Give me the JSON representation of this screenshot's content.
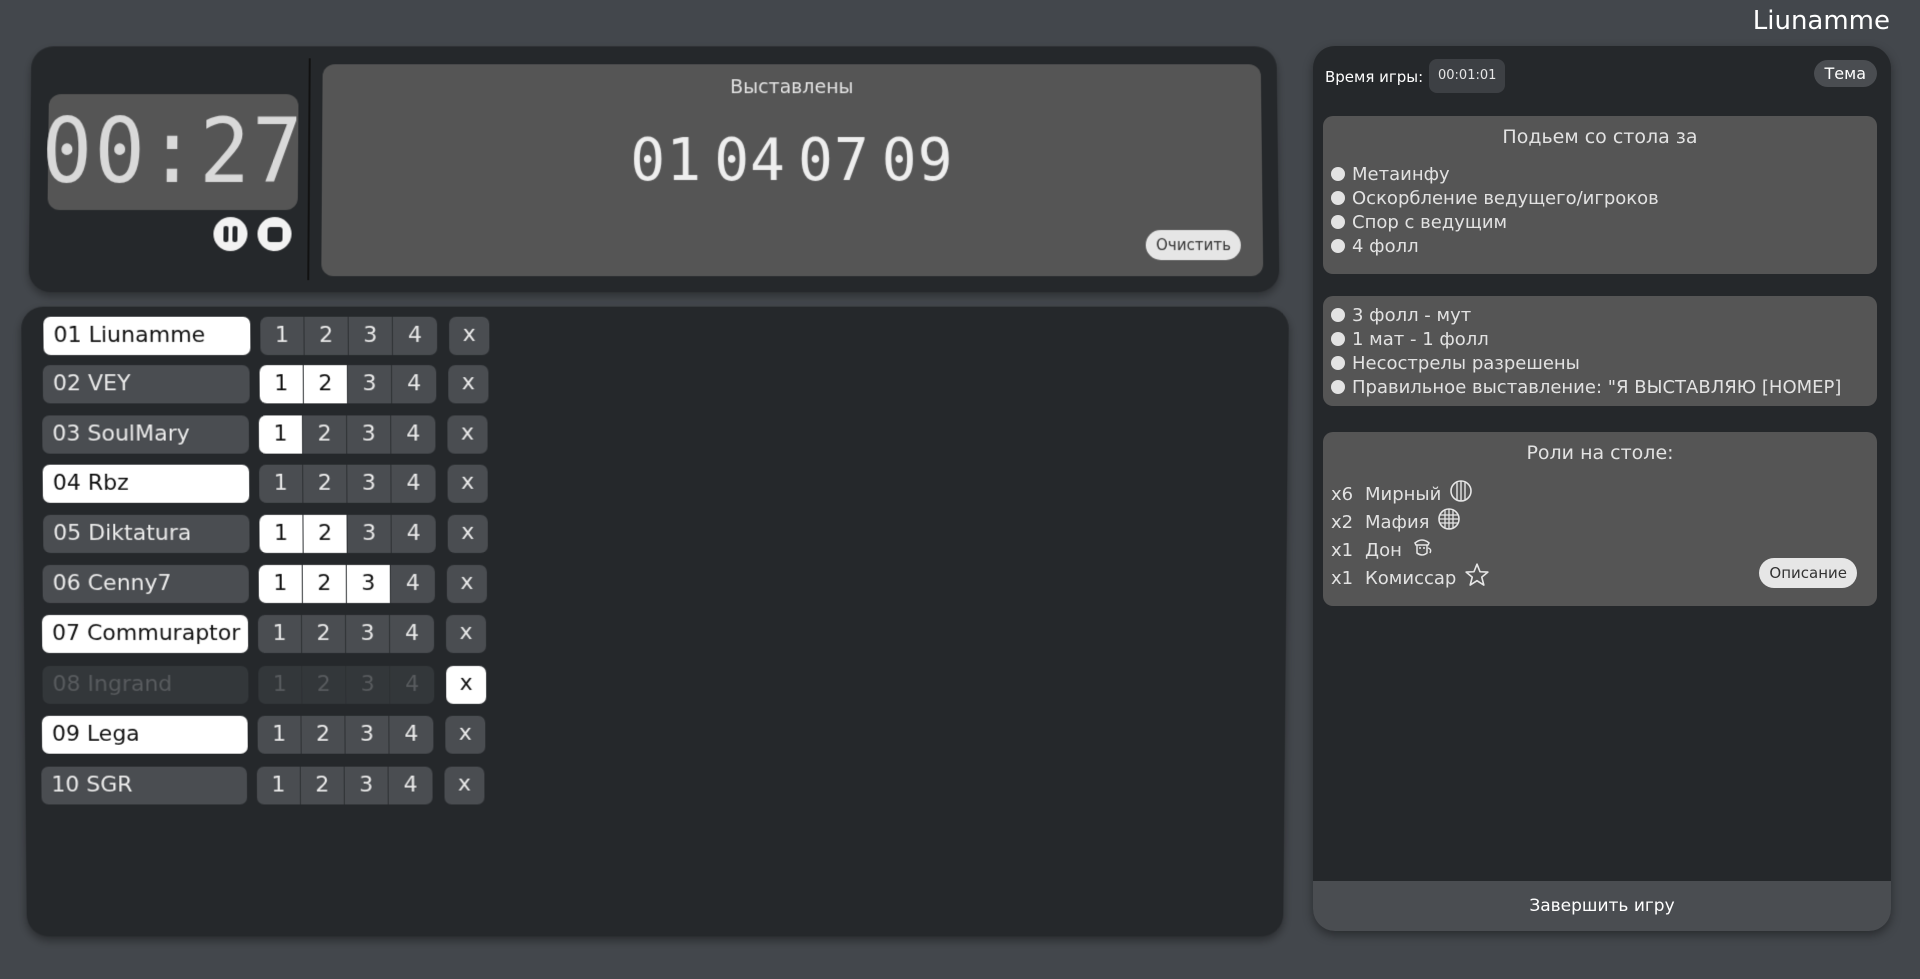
{
  "user": {
    "name": "Liunamme"
  },
  "timer": {
    "value": "00:27",
    "pause_icon": "pause-icon",
    "stop_icon": "stop-icon"
  },
  "nominated": {
    "title": "Выставлены",
    "numbers": [
      "01",
      "04",
      "07",
      "09"
    ],
    "clear_label": "Очистить"
  },
  "players": [
    {
      "label": "01 Liunamme",
      "status": "active",
      "fouls": [
        false,
        false,
        false,
        false
      ],
      "kicked": false
    },
    {
      "label": "02 VEY",
      "status": "normal",
      "fouls": [
        true,
        true,
        false,
        false
      ],
      "kicked": false
    },
    {
      "label": "03 SoulMary",
      "status": "normal",
      "fouls": [
        true,
        false,
        false,
        false
      ],
      "kicked": false
    },
    {
      "label": "04 Rbz",
      "status": "active",
      "fouls": [
        false,
        false,
        false,
        false
      ],
      "kicked": false
    },
    {
      "label": "05 Diktatura",
      "status": "normal",
      "fouls": [
        true,
        true,
        false,
        false
      ],
      "kicked": false
    },
    {
      "label": "06 Cenny7",
      "status": "normal",
      "fouls": [
        true,
        true,
        true,
        false
      ],
      "kicked": false
    },
    {
      "label": "07 Commuraptor",
      "status": "active",
      "fouls": [
        false,
        false,
        false,
        false
      ],
      "kicked": false
    },
    {
      "label": "08 Ingrand",
      "status": "out",
      "fouls": [
        false,
        false,
        false,
        false
      ],
      "kicked": true
    },
    {
      "label": "09 Lega",
      "status": "active",
      "fouls": [
        false,
        false,
        false,
        false
      ],
      "kicked": false
    },
    {
      "label": "10 SGR",
      "status": "normal",
      "fouls": [
        false,
        false,
        false,
        false
      ],
      "kicked": false
    }
  ],
  "foul_labels": [
    "1",
    "2",
    "3",
    "4"
  ],
  "kick_label": "x",
  "game": {
    "time_label": "Время игры:",
    "time_value": "00:01:01",
    "theme_label": "Тема",
    "finish_label": "Завершить игру"
  },
  "rules_removal": {
    "title": "Подьем со стола за",
    "items": [
      "Метаинфу",
      "Оскорбление ведущего/игроков",
      "Спор с ведущим",
      "4 фолл"
    ]
  },
  "rules_general": {
    "items": [
      "3 фолл - мут",
      "1 мат - 1 фолл",
      "Несострелы разрешены",
      "Правильное выставление: \"Я ВЫСТАВЛЯЮ [НОМЕР]"
    ]
  },
  "roles": {
    "title": "Роли на столе:",
    "items": [
      {
        "count": "x6",
        "name": "Мирный",
        "icon": "civilian-icon"
      },
      {
        "count": "x2",
        "name": "Мафия",
        "icon": "mafia-icon"
      },
      {
        "count": "x1",
        "name": "Дон",
        "icon": "don-icon"
      },
      {
        "count": "x1",
        "name": "Комиссар",
        "icon": "star-icon"
      }
    ],
    "description_label": "Описание"
  }
}
